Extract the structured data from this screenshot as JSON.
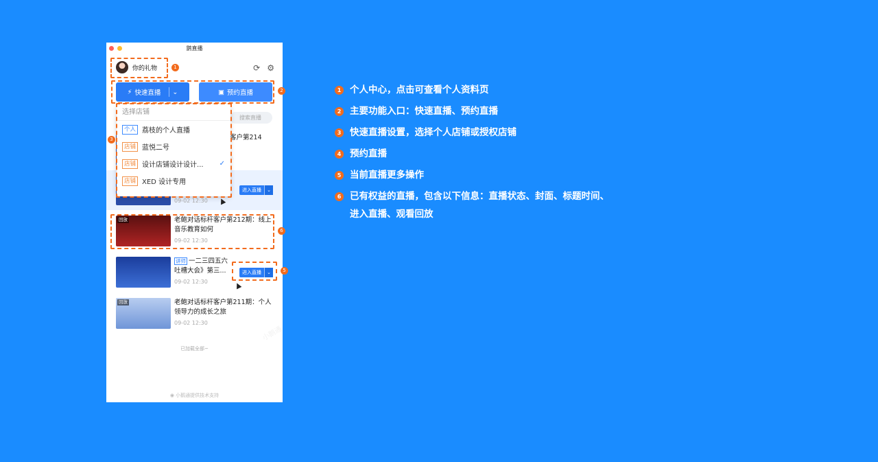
{
  "window": {
    "title": "鹅直播",
    "profile_label": "你的礼物",
    "quick_live_label": "快速直播",
    "book_live_label": "预约直播",
    "search_placeholder": "搜索直播"
  },
  "shop_dropdown": {
    "header": "选择店铺",
    "items": [
      {
        "tag": "个人",
        "tag_color": "#3d8bff",
        "name": "荔枝的个人直播",
        "selected": false
      },
      {
        "tag": "店铺",
        "tag_color": "#f29047",
        "name": "蓝悦二号",
        "selected": false
      },
      {
        "tag": "店铺",
        "tag_color": "#f29047",
        "name": "设计店铺设计设计...",
        "selected": true
      },
      {
        "tag": "店铺",
        "tag_color": "#f29047",
        "name": "XED 设计专用",
        "selected": false
      }
    ]
  },
  "live_list": [
    {
      "badge": "",
      "title": "客户第214",
      "time": "",
      "enter_label": "",
      "thumb_bg": "#2b4da8"
    },
    {
      "badge": "",
      "title": "",
      "time": "09-02 12:30",
      "enter_label": "进入直播",
      "thumb_bg": "#2b4da8"
    },
    {
      "badge": "回放",
      "title": "老鲍对话标杆客户第212期：线上音乐教育如何",
      "time": "09-02 12:30",
      "enter_label": "",
      "thumb_bg": "#7a1c1c"
    },
    {
      "badge": "",
      "label": "讲师",
      "title": "一二三四五六吐槽大会》第三...",
      "time": "09-02 12:30",
      "enter_label": "进入直播",
      "thumb_bg": "#2446a5"
    },
    {
      "badge": "回放",
      "title": "老鲍对话标杆客户第211期：个人领导力的成长之旅",
      "time": "09-02 12:30",
      "enter_label": "",
      "thumb_bg": "#8fb1e8"
    }
  ],
  "loaded_all": "已加载全部~",
  "footer": "小鹅通提供技术支持",
  "watermark": "小鹅通",
  "callouts": [
    "1",
    "2",
    "3",
    "4",
    "5",
    "6"
  ],
  "legend": [
    {
      "num": "1",
      "text": "个人中心，点击可查看个人资料页"
    },
    {
      "num": "2",
      "text": "主要功能入口：快速直播、预约直播"
    },
    {
      "num": "3",
      "text": "快速直播设置，选择个人店铺或授权店铺"
    },
    {
      "num": "4",
      "text": "预约直播"
    },
    {
      "num": "5",
      "text": "当前直播更多操作"
    },
    {
      "num": "6",
      "text": "已有权益的直播，包含以下信息：直播状态、封面、标题时间、进入直播、观看回放"
    }
  ],
  "colors": {
    "background": "#1a8cff",
    "accent": "#2a7cf6",
    "annotation": "#f26b1d"
  }
}
